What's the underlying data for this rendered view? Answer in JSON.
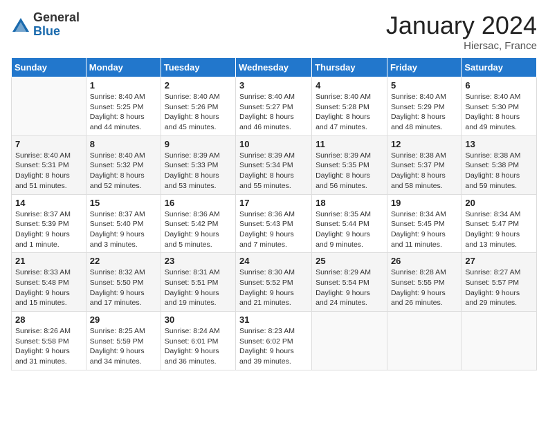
{
  "logo": {
    "general": "General",
    "blue": "Blue"
  },
  "title": "January 2024",
  "location": "Hiersac, France",
  "days_of_week": [
    "Sunday",
    "Monday",
    "Tuesday",
    "Wednesday",
    "Thursday",
    "Friday",
    "Saturday"
  ],
  "weeks": [
    [
      {
        "day": "",
        "info": ""
      },
      {
        "day": "1",
        "info": "Sunrise: 8:40 AM\nSunset: 5:25 PM\nDaylight: 8 hours\nand 44 minutes."
      },
      {
        "day": "2",
        "info": "Sunrise: 8:40 AM\nSunset: 5:26 PM\nDaylight: 8 hours\nand 45 minutes."
      },
      {
        "day": "3",
        "info": "Sunrise: 8:40 AM\nSunset: 5:27 PM\nDaylight: 8 hours\nand 46 minutes."
      },
      {
        "day": "4",
        "info": "Sunrise: 8:40 AM\nSunset: 5:28 PM\nDaylight: 8 hours\nand 47 minutes."
      },
      {
        "day": "5",
        "info": "Sunrise: 8:40 AM\nSunset: 5:29 PM\nDaylight: 8 hours\nand 48 minutes."
      },
      {
        "day": "6",
        "info": "Sunrise: 8:40 AM\nSunset: 5:30 PM\nDaylight: 8 hours\nand 49 minutes."
      }
    ],
    [
      {
        "day": "7",
        "info": "Sunrise: 8:40 AM\nSunset: 5:31 PM\nDaylight: 8 hours\nand 51 minutes."
      },
      {
        "day": "8",
        "info": "Sunrise: 8:40 AM\nSunset: 5:32 PM\nDaylight: 8 hours\nand 52 minutes."
      },
      {
        "day": "9",
        "info": "Sunrise: 8:39 AM\nSunset: 5:33 PM\nDaylight: 8 hours\nand 53 minutes."
      },
      {
        "day": "10",
        "info": "Sunrise: 8:39 AM\nSunset: 5:34 PM\nDaylight: 8 hours\nand 55 minutes."
      },
      {
        "day": "11",
        "info": "Sunrise: 8:39 AM\nSunset: 5:35 PM\nDaylight: 8 hours\nand 56 minutes."
      },
      {
        "day": "12",
        "info": "Sunrise: 8:38 AM\nSunset: 5:37 PM\nDaylight: 8 hours\nand 58 minutes."
      },
      {
        "day": "13",
        "info": "Sunrise: 8:38 AM\nSunset: 5:38 PM\nDaylight: 8 hours\nand 59 minutes."
      }
    ],
    [
      {
        "day": "14",
        "info": "Sunrise: 8:37 AM\nSunset: 5:39 PM\nDaylight: 9 hours\nand 1 minute."
      },
      {
        "day": "15",
        "info": "Sunrise: 8:37 AM\nSunset: 5:40 PM\nDaylight: 9 hours\nand 3 minutes."
      },
      {
        "day": "16",
        "info": "Sunrise: 8:36 AM\nSunset: 5:42 PM\nDaylight: 9 hours\nand 5 minutes."
      },
      {
        "day": "17",
        "info": "Sunrise: 8:36 AM\nSunset: 5:43 PM\nDaylight: 9 hours\nand 7 minutes."
      },
      {
        "day": "18",
        "info": "Sunrise: 8:35 AM\nSunset: 5:44 PM\nDaylight: 9 hours\nand 9 minutes."
      },
      {
        "day": "19",
        "info": "Sunrise: 8:34 AM\nSunset: 5:45 PM\nDaylight: 9 hours\nand 11 minutes."
      },
      {
        "day": "20",
        "info": "Sunrise: 8:34 AM\nSunset: 5:47 PM\nDaylight: 9 hours\nand 13 minutes."
      }
    ],
    [
      {
        "day": "21",
        "info": "Sunrise: 8:33 AM\nSunset: 5:48 PM\nDaylight: 9 hours\nand 15 minutes."
      },
      {
        "day": "22",
        "info": "Sunrise: 8:32 AM\nSunset: 5:50 PM\nDaylight: 9 hours\nand 17 minutes."
      },
      {
        "day": "23",
        "info": "Sunrise: 8:31 AM\nSunset: 5:51 PM\nDaylight: 9 hours\nand 19 minutes."
      },
      {
        "day": "24",
        "info": "Sunrise: 8:30 AM\nSunset: 5:52 PM\nDaylight: 9 hours\nand 21 minutes."
      },
      {
        "day": "25",
        "info": "Sunrise: 8:29 AM\nSunset: 5:54 PM\nDaylight: 9 hours\nand 24 minutes."
      },
      {
        "day": "26",
        "info": "Sunrise: 8:28 AM\nSunset: 5:55 PM\nDaylight: 9 hours\nand 26 minutes."
      },
      {
        "day": "27",
        "info": "Sunrise: 8:27 AM\nSunset: 5:57 PM\nDaylight: 9 hours\nand 29 minutes."
      }
    ],
    [
      {
        "day": "28",
        "info": "Sunrise: 8:26 AM\nSunset: 5:58 PM\nDaylight: 9 hours\nand 31 minutes."
      },
      {
        "day": "29",
        "info": "Sunrise: 8:25 AM\nSunset: 5:59 PM\nDaylight: 9 hours\nand 34 minutes."
      },
      {
        "day": "30",
        "info": "Sunrise: 8:24 AM\nSunset: 6:01 PM\nDaylight: 9 hours\nand 36 minutes."
      },
      {
        "day": "31",
        "info": "Sunrise: 8:23 AM\nSunset: 6:02 PM\nDaylight: 9 hours\nand 39 minutes."
      },
      {
        "day": "",
        "info": ""
      },
      {
        "day": "",
        "info": ""
      },
      {
        "day": "",
        "info": ""
      }
    ]
  ]
}
